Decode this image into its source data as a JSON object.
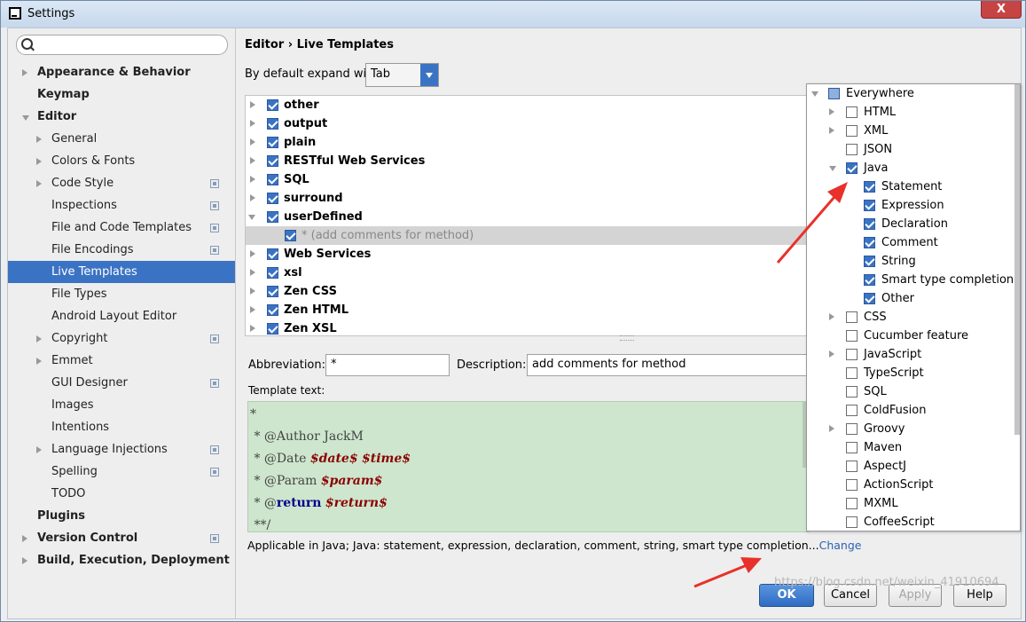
{
  "window": {
    "title": "Settings",
    "close_label": "X"
  },
  "search": {
    "placeholder": ""
  },
  "sidebar": {
    "items": [
      {
        "label": "Appearance & Behavior",
        "level": 0,
        "bold": true,
        "arrow": "right",
        "project": false,
        "selected": false
      },
      {
        "label": "Keymap",
        "level": 0,
        "bold": true,
        "arrow": "none",
        "project": false,
        "selected": false
      },
      {
        "label": "Editor",
        "level": 0,
        "bold": true,
        "arrow": "down",
        "project": false,
        "selected": false
      },
      {
        "label": "General",
        "level": 1,
        "bold": false,
        "arrow": "right",
        "project": false,
        "selected": false
      },
      {
        "label": "Colors & Fonts",
        "level": 1,
        "bold": false,
        "arrow": "right",
        "project": false,
        "selected": false
      },
      {
        "label": "Code Style",
        "level": 1,
        "bold": false,
        "arrow": "right",
        "project": true,
        "selected": false
      },
      {
        "label": "Inspections",
        "level": 1,
        "bold": false,
        "arrow": "none",
        "project": true,
        "selected": false
      },
      {
        "label": "File and Code Templates",
        "level": 1,
        "bold": false,
        "arrow": "none",
        "project": true,
        "selected": false
      },
      {
        "label": "File Encodings",
        "level": 1,
        "bold": false,
        "arrow": "none",
        "project": true,
        "selected": false
      },
      {
        "label": "Live Templates",
        "level": 1,
        "bold": false,
        "arrow": "none",
        "project": false,
        "selected": true
      },
      {
        "label": "File Types",
        "level": 1,
        "bold": false,
        "arrow": "none",
        "project": false,
        "selected": false
      },
      {
        "label": "Android Layout Editor",
        "level": 1,
        "bold": false,
        "arrow": "none",
        "project": false,
        "selected": false
      },
      {
        "label": "Copyright",
        "level": 1,
        "bold": false,
        "arrow": "right",
        "project": true,
        "selected": false
      },
      {
        "label": "Emmet",
        "level": 1,
        "bold": false,
        "arrow": "right",
        "project": false,
        "selected": false
      },
      {
        "label": "GUI Designer",
        "level": 1,
        "bold": false,
        "arrow": "none",
        "project": true,
        "selected": false
      },
      {
        "label": "Images",
        "level": 1,
        "bold": false,
        "arrow": "none",
        "project": false,
        "selected": false
      },
      {
        "label": "Intentions",
        "level": 1,
        "bold": false,
        "arrow": "none",
        "project": false,
        "selected": false
      },
      {
        "label": "Language Injections",
        "level": 1,
        "bold": false,
        "arrow": "right",
        "project": true,
        "selected": false
      },
      {
        "label": "Spelling",
        "level": 1,
        "bold": false,
        "arrow": "none",
        "project": true,
        "selected": false
      },
      {
        "label": "TODO",
        "level": 1,
        "bold": false,
        "arrow": "none",
        "project": false,
        "selected": false
      },
      {
        "label": "Plugins",
        "level": 0,
        "bold": true,
        "arrow": "none",
        "project": false,
        "selected": false
      },
      {
        "label": "Version Control",
        "level": 0,
        "bold": true,
        "arrow": "right",
        "project": true,
        "selected": false
      },
      {
        "label": "Build, Execution, Deployment",
        "level": 0,
        "bold": true,
        "arrow": "right",
        "project": false,
        "selected": false
      }
    ]
  },
  "header": {
    "breadcrumb_parent": "Editor",
    "breadcrumb_sep": "›",
    "breadcrumb_current": "Live Templates",
    "expand_label": "By default expand with",
    "expand_value": "Tab"
  },
  "templates": [
    {
      "label": "other",
      "checked": true,
      "arrow": "right",
      "child": false,
      "selected": false
    },
    {
      "label": "output",
      "checked": true,
      "arrow": "right",
      "child": false,
      "selected": false
    },
    {
      "label": "plain",
      "checked": true,
      "arrow": "right",
      "child": false,
      "selected": false
    },
    {
      "label": "RESTful Web Services",
      "checked": true,
      "arrow": "right",
      "child": false,
      "selected": false
    },
    {
      "label": "SQL",
      "checked": true,
      "arrow": "right",
      "child": false,
      "selected": false
    },
    {
      "label": "surround",
      "checked": true,
      "arrow": "right",
      "child": false,
      "selected": false
    },
    {
      "label": "userDefined",
      "checked": true,
      "arrow": "down",
      "child": false,
      "selected": false
    },
    {
      "label": "* (add comments for method)",
      "checked": true,
      "arrow": "none",
      "child": true,
      "selected": true
    },
    {
      "label": "Web Services",
      "checked": true,
      "arrow": "right",
      "child": false,
      "selected": false
    },
    {
      "label": "xsl",
      "checked": true,
      "arrow": "right",
      "child": false,
      "selected": false
    },
    {
      "label": "Zen CSS",
      "checked": true,
      "arrow": "right",
      "child": false,
      "selected": false
    },
    {
      "label": "Zen HTML",
      "checked": true,
      "arrow": "right",
      "child": false,
      "selected": false
    },
    {
      "label": "Zen XSL",
      "checked": true,
      "arrow": "right",
      "child": false,
      "selected": false
    }
  ],
  "form": {
    "abbreviation_label": "Abbreviation:",
    "abbreviation_value": "*",
    "description_label": "Description:",
    "description_value": "add comments for method",
    "template_text_label": "Template text:"
  },
  "template_text": [
    {
      "parts": [
        {
          "t": "*",
          "c": "plain"
        }
      ]
    },
    {
      "parts": [
        {
          "t": " * @Author JackM",
          "c": "plain"
        }
      ]
    },
    {
      "parts": [
        {
          "t": " * @Date ",
          "c": "plain"
        },
        {
          "t": "$date$",
          "c": "var"
        },
        {
          "t": " ",
          "c": "plain"
        },
        {
          "t": "$time$",
          "c": "var"
        }
      ]
    },
    {
      "parts": [
        {
          "t": " * @Param ",
          "c": "plain"
        },
        {
          "t": "$param$",
          "c": "var"
        }
      ]
    },
    {
      "parts": [
        {
          "t": " * @",
          "c": "plain"
        },
        {
          "t": "return",
          "c": "kw"
        },
        {
          "t": " ",
          "c": "plain"
        },
        {
          "t": "$return$",
          "c": "var"
        }
      ]
    },
    {
      "parts": [
        {
          "t": " **/",
          "c": "plain"
        }
      ]
    }
  ],
  "applicable": {
    "text": "Applicable in Java; Java: statement, expression, declaration, comment, string, smart type completion...",
    "link": "Change"
  },
  "context_popup": [
    {
      "label": "Everywhere",
      "level": 0,
      "state": "partial",
      "arrow": "down"
    },
    {
      "label": "HTML",
      "level": 1,
      "state": "off",
      "arrow": "right"
    },
    {
      "label": "XML",
      "level": 1,
      "state": "off",
      "arrow": "right"
    },
    {
      "label": "JSON",
      "level": 1,
      "state": "off",
      "arrow": "none"
    },
    {
      "label": "Java",
      "level": 1,
      "state": "on",
      "arrow": "down"
    },
    {
      "label": "Statement",
      "level": 2,
      "state": "on",
      "arrow": "none"
    },
    {
      "label": "Expression",
      "level": 2,
      "state": "on",
      "arrow": "none"
    },
    {
      "label": "Declaration",
      "level": 2,
      "state": "on",
      "arrow": "none"
    },
    {
      "label": "Comment",
      "level": 2,
      "state": "on",
      "arrow": "none"
    },
    {
      "label": "String",
      "level": 2,
      "state": "on",
      "arrow": "none"
    },
    {
      "label": "Smart type completion",
      "level": 2,
      "state": "on",
      "arrow": "none"
    },
    {
      "label": "Other",
      "level": 2,
      "state": "on",
      "arrow": "none"
    },
    {
      "label": "CSS",
      "level": 1,
      "state": "off",
      "arrow": "right"
    },
    {
      "label": "Cucumber feature",
      "level": 1,
      "state": "off",
      "arrow": "none"
    },
    {
      "label": "JavaScript",
      "level": 1,
      "state": "off",
      "arrow": "right"
    },
    {
      "label": "TypeScript",
      "level": 1,
      "state": "off",
      "arrow": "none"
    },
    {
      "label": "SQL",
      "level": 1,
      "state": "off",
      "arrow": "none"
    },
    {
      "label": "ColdFusion",
      "level": 1,
      "state": "off",
      "arrow": "none"
    },
    {
      "label": "Groovy",
      "level": 1,
      "state": "off",
      "arrow": "right"
    },
    {
      "label": "Maven",
      "level": 1,
      "state": "off",
      "arrow": "none"
    },
    {
      "label": "AspectJ",
      "level": 1,
      "state": "off",
      "arrow": "none"
    },
    {
      "label": "ActionScript",
      "level": 1,
      "state": "off",
      "arrow": "none"
    },
    {
      "label": "MXML",
      "level": 1,
      "state": "off",
      "arrow": "none"
    },
    {
      "label": "CoffeeScript",
      "level": 1,
      "state": "off",
      "arrow": "none"
    }
  ],
  "buttons": {
    "ok": "OK",
    "cancel": "Cancel",
    "apply": "Apply",
    "help": "Help"
  },
  "watermark": "https://blog.csdn.net/weixin_41910694",
  "colors": {
    "selection": "#3b73c4",
    "editor_bg": "#cde6cd",
    "annotation_arrow": "#e8312a",
    "link": "#2a62b5"
  }
}
